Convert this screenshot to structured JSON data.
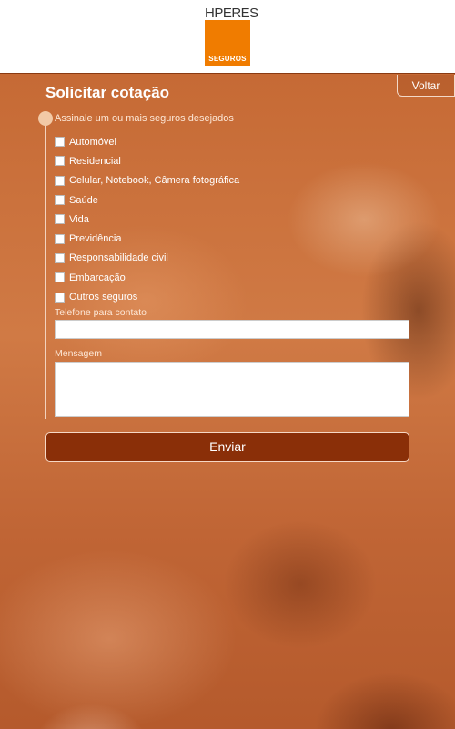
{
  "header": {
    "logo_top": "HPERES",
    "logo_bottom": "SEGUROS",
    "brand_color": "#f07c00"
  },
  "nav": {
    "back_label": "Voltar"
  },
  "form": {
    "title": "Solicitar cotação",
    "instruction": "Assinale um ou mais seguros desejados",
    "options": [
      {
        "label": "Automóvel"
      },
      {
        "label": "Residencial"
      },
      {
        "label": "Celular, Notebook, Câmera fotográfica"
      },
      {
        "label": "Saúde"
      },
      {
        "label": "Vida"
      },
      {
        "label": "Previdência"
      },
      {
        "label": "Responsabilidade civil"
      },
      {
        "label": "Embarcação"
      },
      {
        "label": "Outros seguros"
      }
    ],
    "phone_label": "Telefone para contato",
    "phone_value": "",
    "message_label": "Mensagem",
    "message_value": "",
    "submit_label": "Enviar"
  }
}
